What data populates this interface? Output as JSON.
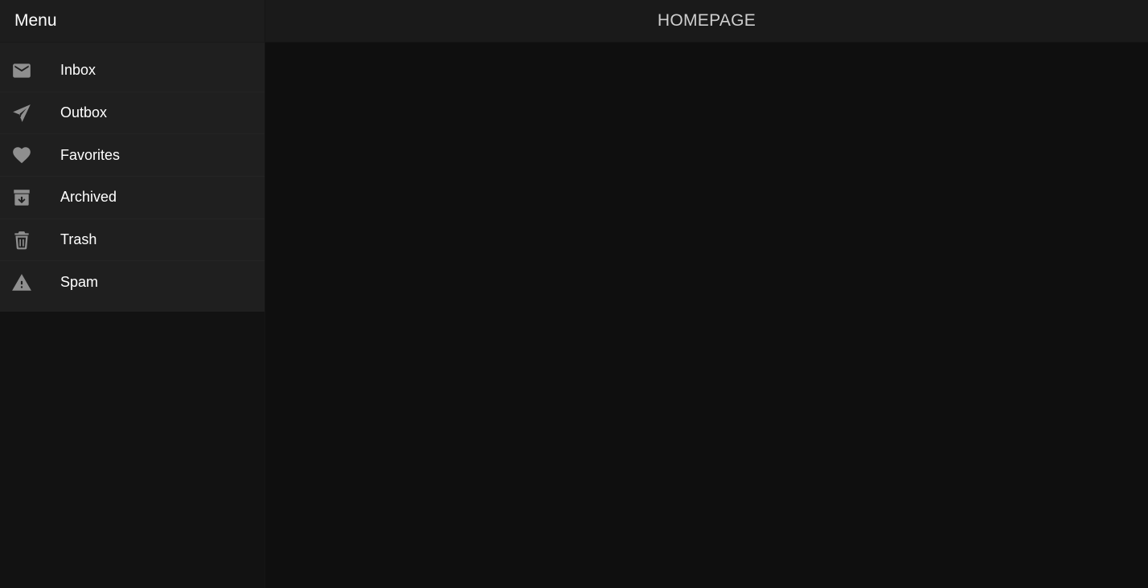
{
  "drawer": {
    "title": "Menu",
    "items": [
      {
        "label": "Inbox",
        "icon": "mail-icon"
      },
      {
        "label": "Outbox",
        "icon": "send-icon"
      },
      {
        "label": "Favorites",
        "icon": "heart-icon"
      },
      {
        "label": "Archived",
        "icon": "archive-icon"
      },
      {
        "label": "Trash",
        "icon": "trash-icon"
      },
      {
        "label": "Spam",
        "icon": "warning-icon"
      }
    ]
  },
  "topbar": {
    "title": "HOMEPAGE"
  },
  "colors": {
    "background": "#0f0f0f",
    "drawer_bg": "#1f1f1f",
    "topbar_bg": "#1a1a1a",
    "icon": "#8f8f8f",
    "text": "#ffffff",
    "title_text": "#cfcfcf"
  }
}
